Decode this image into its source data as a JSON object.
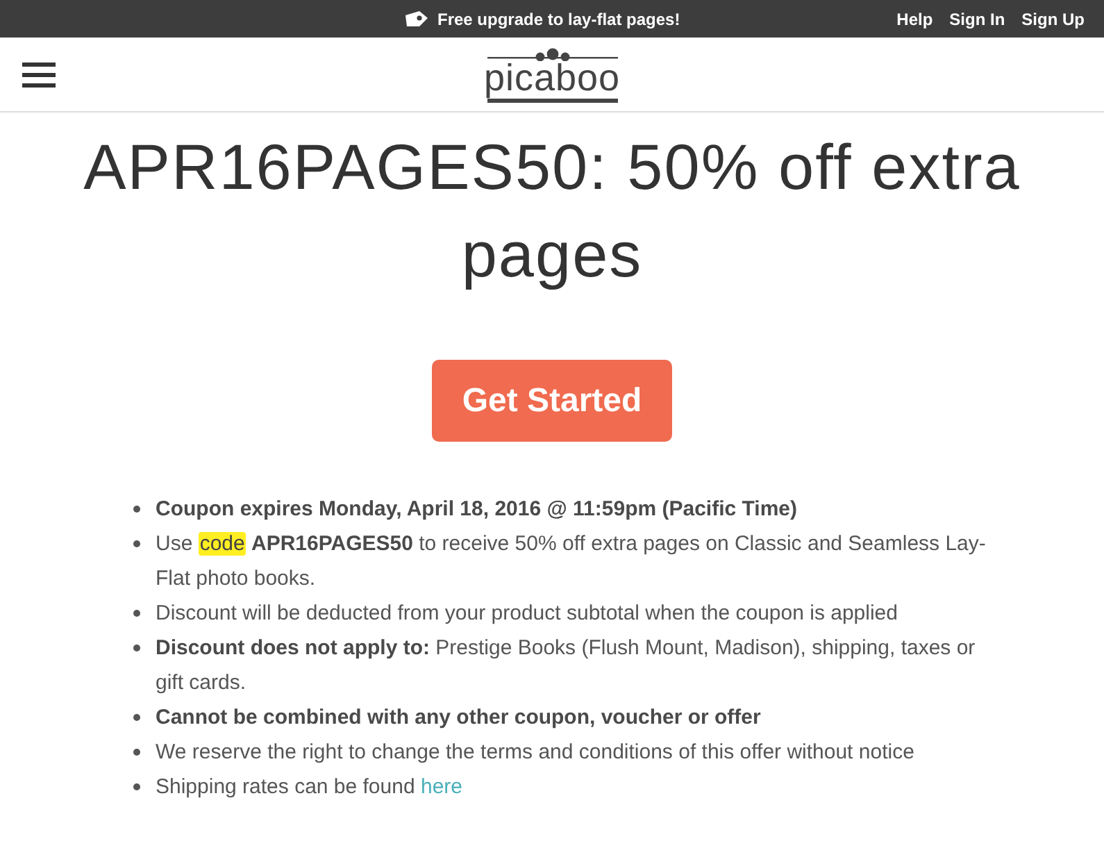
{
  "top_bar": {
    "promo": "Free upgrade to lay-flat pages!",
    "links": [
      "Help",
      "Sign In",
      "Sign Up"
    ]
  },
  "header": {
    "logo": "picaboo"
  },
  "title": "APR16PAGES50: 50% off extra pages",
  "cta": "Get Started",
  "terms": [
    {
      "segments": [
        {
          "kind": "bold",
          "text": "Coupon expires Monday, April 18, 2016 @ 11:59pm (Pacific Time)"
        }
      ]
    },
    {
      "segments": [
        {
          "kind": "plain",
          "text": "Use "
        },
        {
          "kind": "highlight",
          "text": "code"
        },
        {
          "kind": "bold",
          "text": " APR16PAGES50"
        },
        {
          "kind": "plain",
          "text": " to receive 50% off extra pages on Classic and Seamless Lay-Flat photo books."
        }
      ]
    },
    {
      "segments": [
        {
          "kind": "plain",
          "text": "Discount will be deducted from your product subtotal when the coupon is applied"
        }
      ]
    },
    {
      "segments": [
        {
          "kind": "bold",
          "text": "Discount does not apply to:"
        },
        {
          "kind": "plain",
          "text": " Prestige Books (Flush Mount, Madison), shipping, taxes or gift cards."
        }
      ]
    },
    {
      "segments": [
        {
          "kind": "bold",
          "text": "Cannot be combined with any other coupon, voucher or offer"
        }
      ]
    },
    {
      "segments": [
        {
          "kind": "plain",
          "text": "We reserve the right to change the terms and conditions of this offer without notice"
        }
      ]
    },
    {
      "segments": [
        {
          "kind": "plain",
          "text": "Shipping rates can be found "
        },
        {
          "kind": "link",
          "text": "here"
        }
      ]
    }
  ]
}
